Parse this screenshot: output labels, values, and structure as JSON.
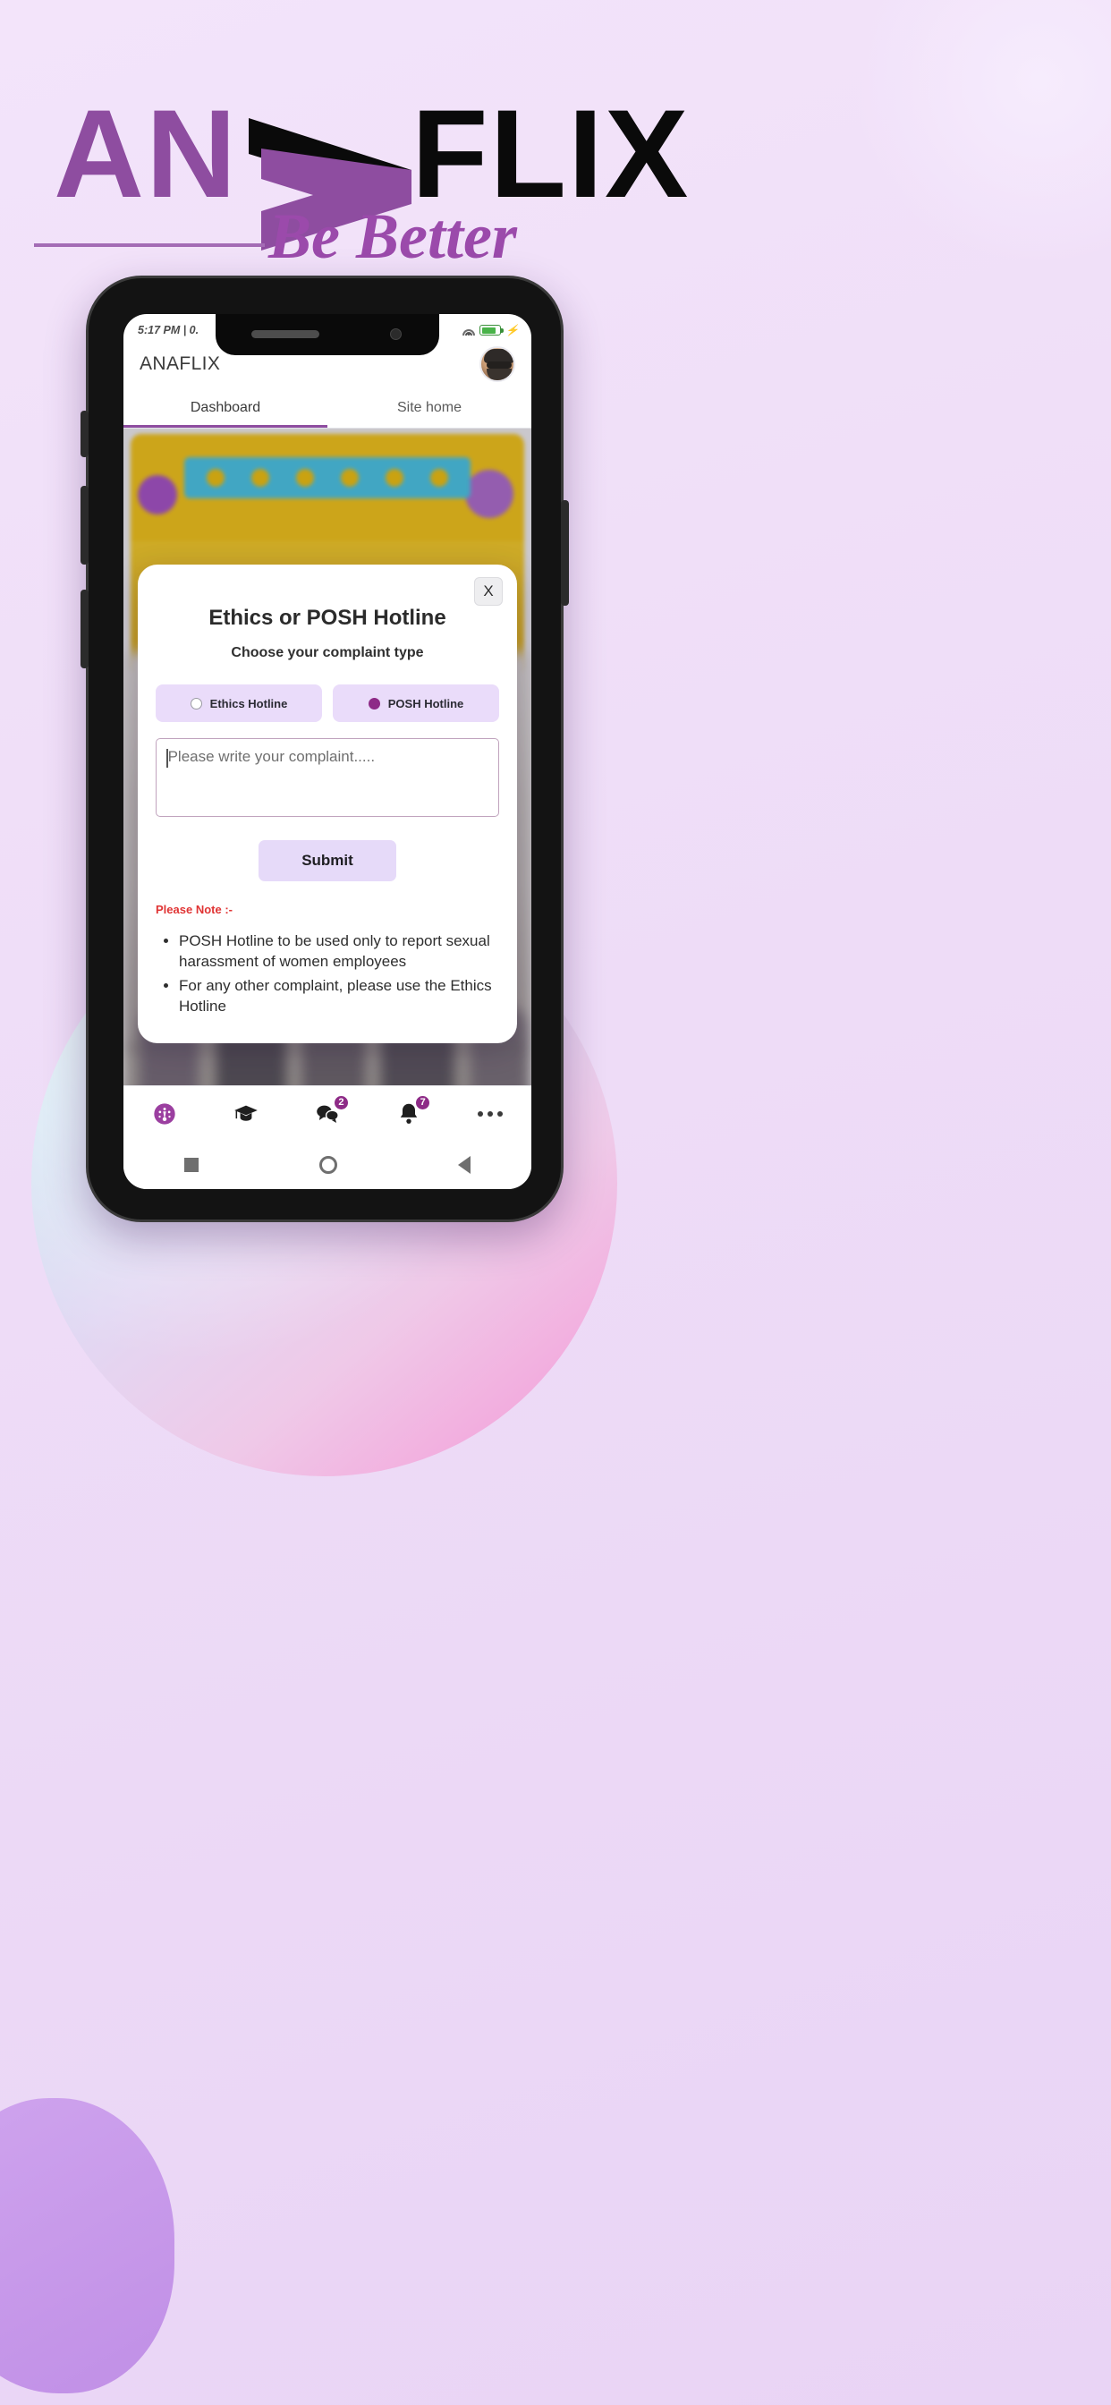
{
  "brand": {
    "wordmark_part1": "ANA",
    "wordmark_part2": "FLIX",
    "tagline": "Be Better",
    "purple": "#8e4da0",
    "black": "#0a0a0a"
  },
  "phone": {
    "statusbar": {
      "time": "5:17 PM | 0.",
      "wifi_icon": "wifi-icon",
      "battery_icon": "battery-charging-icon",
      "bolt_icon": "bolt-icon"
    },
    "header": {
      "app_title": "ANAFLIX",
      "avatar_icon": "user-avatar"
    },
    "tabs": [
      {
        "label": "Dashboard",
        "active": true
      },
      {
        "label": "Site home",
        "active": false
      }
    ],
    "modal": {
      "close_label": "X",
      "title": "Ethics or POSH Hotline",
      "subtitle": "Choose your complaint type",
      "choices": [
        {
          "label": "Ethics Hotline",
          "selected": false
        },
        {
          "label": "POSH Hotline",
          "selected": true
        }
      ],
      "complaint_placeholder": "Please write your complaint.....",
      "complaint_value": "",
      "submit_label": "Submit",
      "note_title": "Please Note :-",
      "notes": [
        "POSH Hotline to be used only to report sexual harassment of women employees",
        "For any other complaint, please use the Ethics Hotline"
      ],
      "accent": "#8e2b87",
      "note_color": "#e03434"
    },
    "bottom_nav": [
      {
        "icon": "dashboard-gauge-icon",
        "badge": "",
        "active": true
      },
      {
        "icon": "graduation-cap-icon",
        "badge": "",
        "active": false
      },
      {
        "icon": "chat-bubbles-icon",
        "badge": "2",
        "active": false
      },
      {
        "icon": "bell-icon",
        "badge": "7",
        "active": false
      },
      {
        "icon": "more-dots-icon",
        "badge": "",
        "active": false
      }
    ],
    "system_nav": [
      {
        "icon": "android-recents-square-icon"
      },
      {
        "icon": "android-home-circle-icon"
      },
      {
        "icon": "android-back-triangle-icon"
      }
    ]
  }
}
